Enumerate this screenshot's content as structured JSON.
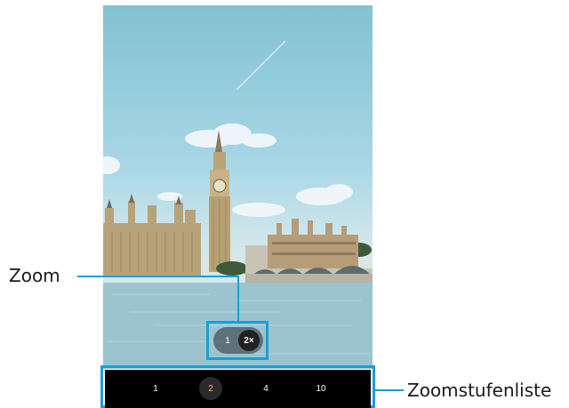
{
  "callouts": {
    "zoom": "Zoom",
    "zoom_levels": "Zoomstufenliste"
  },
  "zoom_control": {
    "options": [
      "1",
      "2×"
    ],
    "selected": "2×"
  },
  "zoom_levels": {
    "items": [
      "1",
      "2",
      "4",
      "10"
    ],
    "selected": "2"
  },
  "colors": {
    "callout_line": "#1a9fd6",
    "selected_level_text": "#f2c14e",
    "levels_bar": "#000000"
  }
}
